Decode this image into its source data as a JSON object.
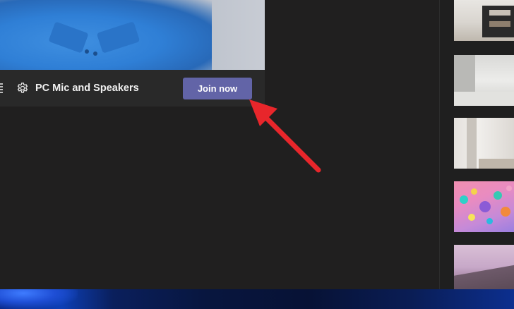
{
  "audio": {
    "device_label": "PC Mic and Speakers",
    "settings_icon": "gear-icon"
  },
  "actions": {
    "join_label": "Join now"
  },
  "colors": {
    "accent": "#6264a7",
    "annotation_arrow": "#e8262b",
    "background": "#201f1f"
  },
  "backgrounds": {
    "count_visible": 5
  }
}
